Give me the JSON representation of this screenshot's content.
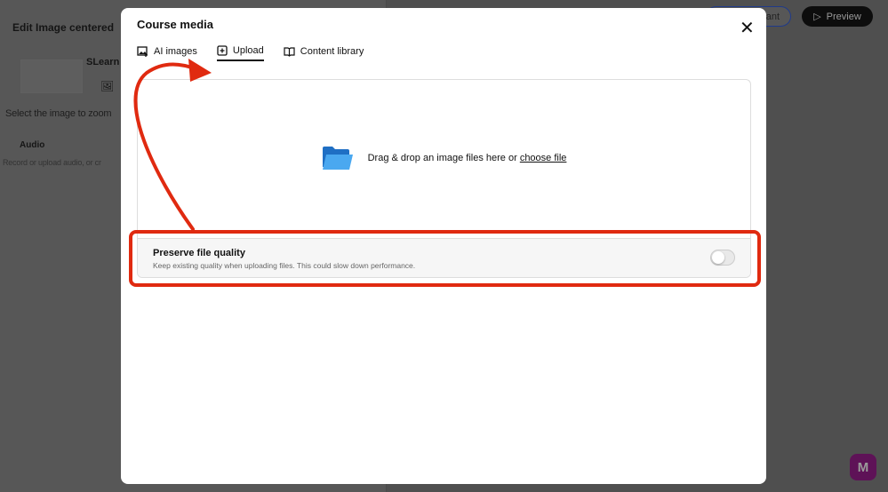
{
  "background": {
    "panel_title": "Edit Image centered",
    "media_name": "SLearn",
    "select_hint": "Select the image to zoom",
    "audio_label": "Audio",
    "audio_hint": "Record or upload audio, or cr",
    "assistant_button": "ant",
    "preview_button": "Preview",
    "logo_letter": "M"
  },
  "modal": {
    "title": "Course media",
    "tabs": [
      {
        "label": "AI images",
        "icon": "image-plus-icon"
      },
      {
        "label": "Upload",
        "icon": "plus-square-icon",
        "active": true
      },
      {
        "label": "Content library",
        "icon": "book-icon"
      }
    ],
    "drop_text": "Drag & drop an image files here or",
    "choose_file": "choose file",
    "preserve": {
      "title": "Preserve file quality",
      "description": "Keep existing quality when uploading files. This could slow down performance.",
      "enabled": false
    }
  },
  "annotation_color": "#e02a10"
}
